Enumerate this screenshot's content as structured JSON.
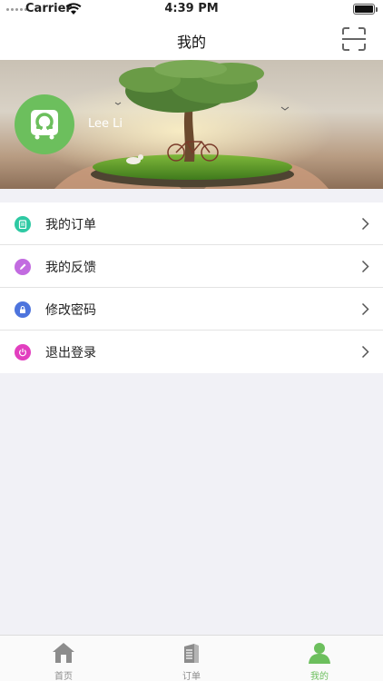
{
  "status_bar": {
    "carrier": "Carrier",
    "time": "4:39 PM"
  },
  "nav": {
    "title": "我的",
    "action_icon": "scan-icon"
  },
  "profile": {
    "user_name": "Lee Li",
    "avatar_icon": "logo-icon",
    "avatar_color": "#6cbf5d"
  },
  "menu": {
    "items": [
      {
        "label": "我的订单",
        "icon": "clipboard-icon",
        "color": "#2ec9a3"
      },
      {
        "label": "我的反馈",
        "icon": "pencil-icon",
        "color": "#c26be0"
      },
      {
        "label": "修改密码",
        "icon": "lock-icon",
        "color": "#4d74dd"
      },
      {
        "label": "退出登录",
        "icon": "power-icon",
        "color": "#e23fbf"
      }
    ]
  },
  "tabs": [
    {
      "label": "首页",
      "icon": "home-icon",
      "active": false
    },
    {
      "label": "订单",
      "icon": "document-icon",
      "active": false
    },
    {
      "label": "我的",
      "icon": "user-icon",
      "active": true
    }
  ],
  "colors": {
    "accent": "#6cbf5d",
    "background": "#f1f1f6"
  }
}
